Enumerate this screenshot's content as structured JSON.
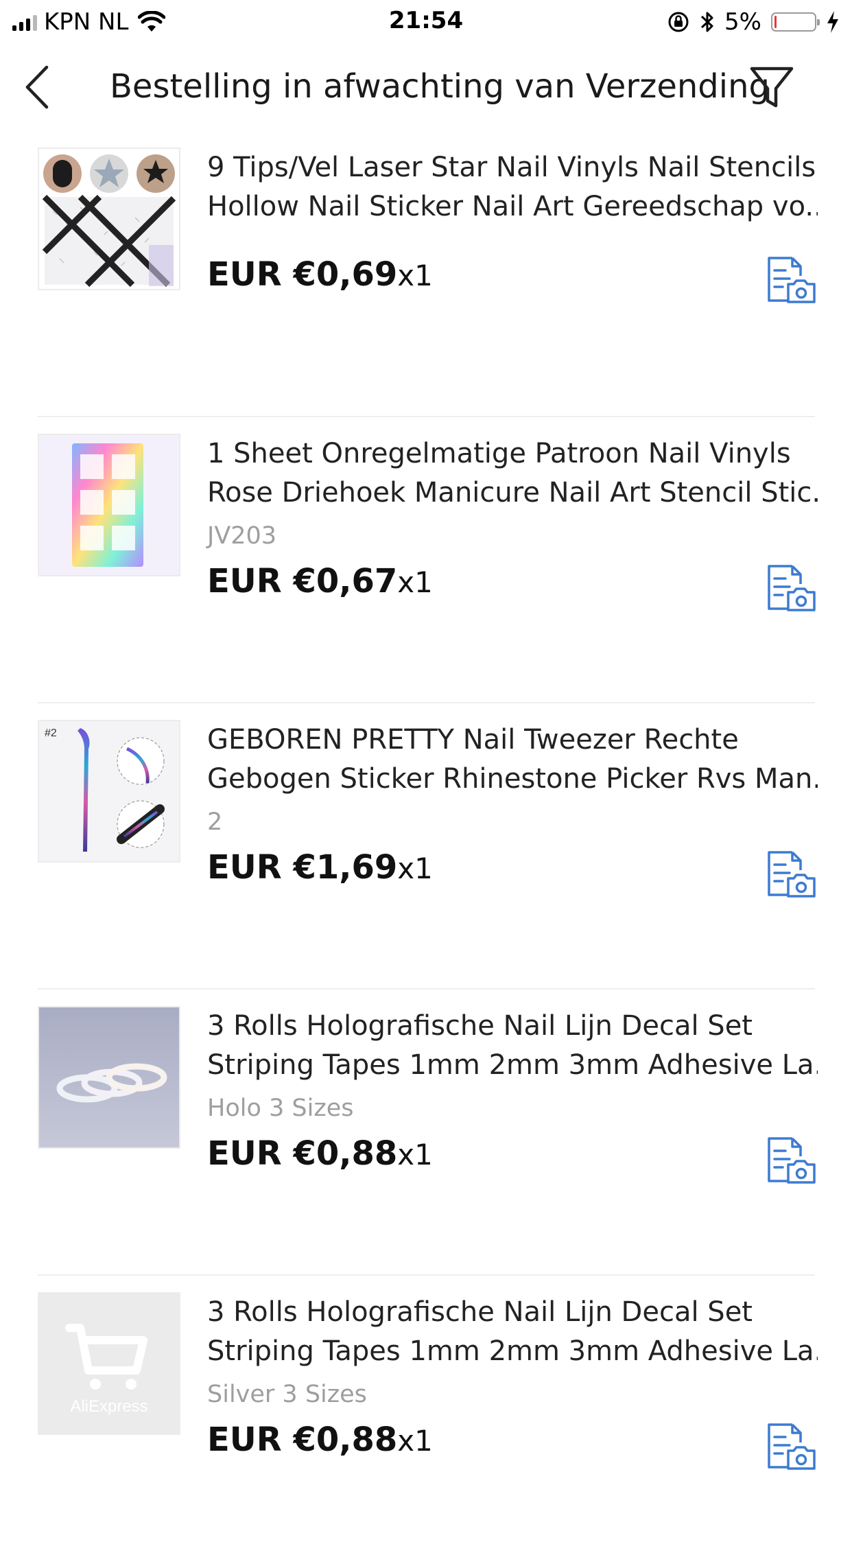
{
  "status_bar": {
    "carrier": "KPN NL",
    "time": "21:54",
    "battery": "5%",
    "battery_level": 0.05
  },
  "nav": {
    "title": "Bestelling in afwachting van Verzending"
  },
  "accent_color": "#3d7bd1",
  "items": [
    {
      "title_line1": "9 Tips/Vel Laser Star Nail Vinyls Nail Stencils",
      "title_line2": "Hollow Nail Sticker Nail Art Gereedschap vo...",
      "variant": "",
      "price": "EUR €0,69",
      "qty": "x1"
    },
    {
      "title_line1": "1 Sheet Onregelmatige Patroon Nail Vinyls",
      "title_line2": "Rose Driehoek Manicure Nail Art Stencil Stic...",
      "variant": "JV203",
      "price": "EUR €0,67",
      "qty": "x1"
    },
    {
      "title_line1": "GEBOREN PRETTY Nail Tweezer Rechte",
      "title_line2": "Gebogen Sticker Rhinestone Picker Rvs Man...",
      "variant": "2",
      "price": "EUR €1,69",
      "qty": "x1",
      "thumb_label": "#2"
    },
    {
      "title_line1": "3 Rolls Holografische Nail Lijn Decal Set",
      "title_line2": "Striping Tapes 1mm 2mm 3mm Adhesive La...",
      "variant": "Holo 3 Sizes",
      "price": "EUR €0,88",
      "qty": "x1"
    },
    {
      "title_line1": "3 Rolls Holografische Nail Lijn Decal Set",
      "title_line2": "Striping Tapes 1mm 2mm 3mm Adhesive La...",
      "variant": "Silver 3 Sizes",
      "price": "EUR €0,88",
      "qty": "x1",
      "thumb_label": "AliExpress"
    }
  ]
}
